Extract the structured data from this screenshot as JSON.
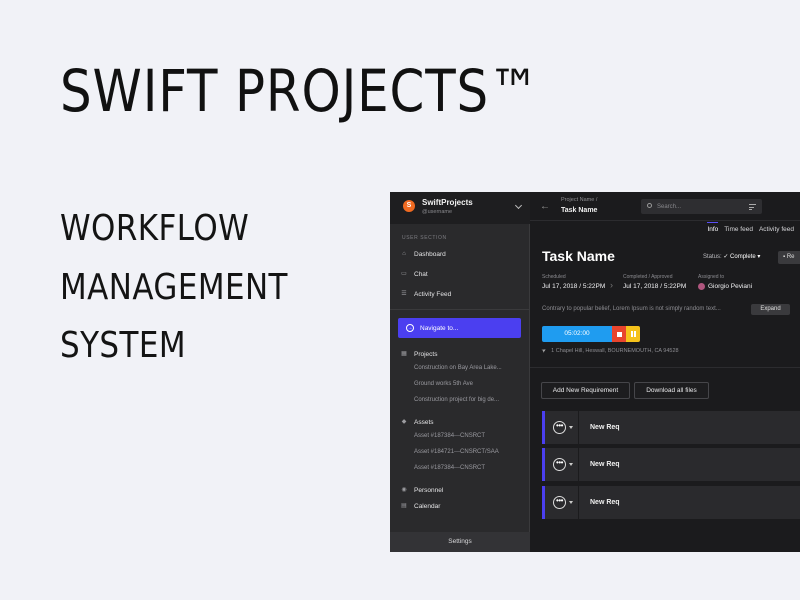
{
  "hero": {
    "title": "SWIFT PROJECTS™",
    "subtitle_lines": [
      "WORKFLOW",
      "MANAGEMENT",
      "SYSTEM"
    ]
  },
  "sidebar": {
    "brand_initial": "S",
    "brand_name": "SwiftProjects",
    "username": "@username",
    "section_label": "USER SECTION",
    "items": [
      {
        "label": "Dashboard",
        "icon": "home-icon"
      },
      {
        "label": "Chat",
        "icon": "chat-icon"
      },
      {
        "label": "Activity Feed",
        "icon": "list-icon"
      }
    ],
    "navigate_label": "Navigate to...",
    "projects_label": "Projects",
    "projects": [
      "Construction on Bay Area Lake...",
      "Ground works 5th Ave",
      "Construction project for big de..."
    ],
    "assets_label": "Assets",
    "assets": [
      "Asset #187384---CNSRCT",
      "Asset #184721---CNSRCT/SAA",
      "Asset #187384---CNSRCT"
    ],
    "personnel_label": "Personnel",
    "calendar_label": "Calendar",
    "settings_label": "Settings"
  },
  "header": {
    "breadcrumb": "Project Name /",
    "title": "Task Name",
    "search_placeholder": "Search..."
  },
  "tabs": [
    "Info",
    "Time feed",
    "Activity feed"
  ],
  "task": {
    "title": "Task Name",
    "status_label": "Status:",
    "status_value": "✓ Complete ▾",
    "re_button": "Re",
    "scheduled_label": "Scheduled",
    "scheduled_value": "Jul 17, 2018 / 5:22PM",
    "completed_label": "Completed / Approved",
    "completed_value": "Jul 17, 2018 / 5:22PM",
    "assigned_label": "Assigned to",
    "assigned_value": "Giorgio Peviani",
    "description": "Contrary to popular belief, Lorem Ipsum is not simply random text...",
    "expand_label": "Expand",
    "timer": "05:02:00",
    "location": "1 Chapel Hill, Heswall, BOURNEMOUTH, CA 94528"
  },
  "actions": {
    "add_requirement": "Add New Requirement",
    "download_all": "Download all files"
  },
  "requirements": [
    {
      "label": "New Req"
    },
    {
      "label": "New Req"
    },
    {
      "label": "New Req"
    }
  ],
  "colors": {
    "accent": "#4b3ff0",
    "timer": "#1f9cf0",
    "stop": "#e8442d",
    "pause": "#f5c21b",
    "brand": "#f06a21"
  }
}
